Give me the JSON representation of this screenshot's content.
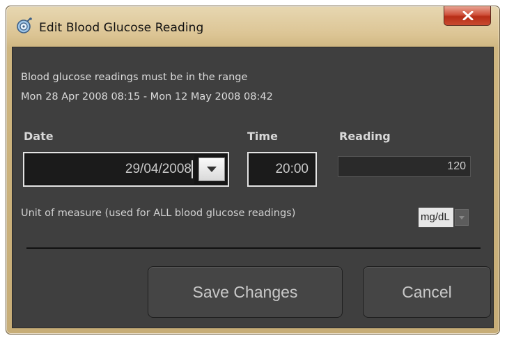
{
  "window": {
    "title": "Edit Blood Glucose Reading",
    "icon": "glucose-meter-icon",
    "close_icon": "close-x-icon"
  },
  "info": {
    "line1": "Blood glucose readings must be in the range",
    "line2": "Mon 28 Apr 2008 08:15 - Mon 12 May 2008 08:42"
  },
  "fields": {
    "date_label": "Date",
    "date_value": "29/04/2008",
    "time_label": "Time",
    "time_value": "20:00",
    "reading_label": "Reading",
    "reading_value": "120"
  },
  "unit": {
    "label": "Unit of measure (used for ALL blood glucose readings)",
    "selected": "mg/dL"
  },
  "buttons": {
    "save": "Save Changes",
    "cancel": "Cancel"
  },
  "colors": {
    "titlebar": "#dcc595",
    "client_bg": "#3f3f3f",
    "close_button": "#c84a30"
  }
}
